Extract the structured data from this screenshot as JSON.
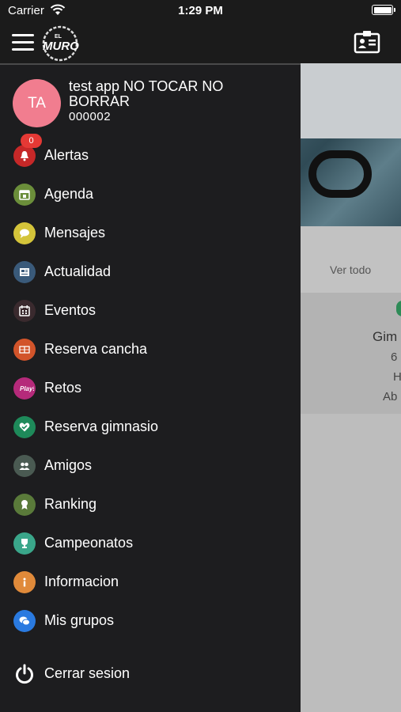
{
  "status_bar": {
    "carrier": "Carrier",
    "time": "1:29 PM"
  },
  "app": {
    "logo_text": "MURO",
    "logo_small": "EL"
  },
  "user": {
    "initials": "TA",
    "name": "test app NO TOCAR NO BORRAR",
    "id": "000002"
  },
  "menu": [
    {
      "label": "Alertas",
      "icon": "bell-icon",
      "color": "#c62828",
      "badge": "0"
    },
    {
      "label": "Agenda",
      "icon": "calendar-icon",
      "color": "#6b8e3a"
    },
    {
      "label": "Mensajes",
      "icon": "chat-icon",
      "color": "#d4c43a"
    },
    {
      "label": "Actualidad",
      "icon": "news-icon",
      "color": "#3a5a7a"
    },
    {
      "label": "Eventos",
      "icon": "event-icon",
      "color": "#3a2a2e"
    },
    {
      "label": "Reserva cancha",
      "icon": "court-icon",
      "color": "#d2542a"
    },
    {
      "label": "Retos",
      "icon": "play-icon",
      "color": "#b52a7a",
      "icon_text": "Play!"
    },
    {
      "label": "Reserva gimnasio",
      "icon": "gym-icon",
      "color": "#1e8a5a"
    },
    {
      "label": "Amigos",
      "icon": "friends-icon",
      "color": "#4a5a52"
    },
    {
      "label": "Ranking",
      "icon": "ranking-icon",
      "color": "#5a7a3a"
    },
    {
      "label": "Campeonatos",
      "icon": "trophy-icon",
      "color": "#3aa68a"
    },
    {
      "label": "Informacion",
      "icon": "info-icon",
      "color": "#e08a3a"
    },
    {
      "label": "Mis grupos",
      "icon": "groups-icon",
      "color": "#2a7ae0"
    }
  ],
  "logout_label": "Cerrar sesion",
  "background": {
    "ver_todo": "Ver todo",
    "card_title": "Gim",
    "line1": "6",
    "line2": "H",
    "line3": "Ab"
  }
}
